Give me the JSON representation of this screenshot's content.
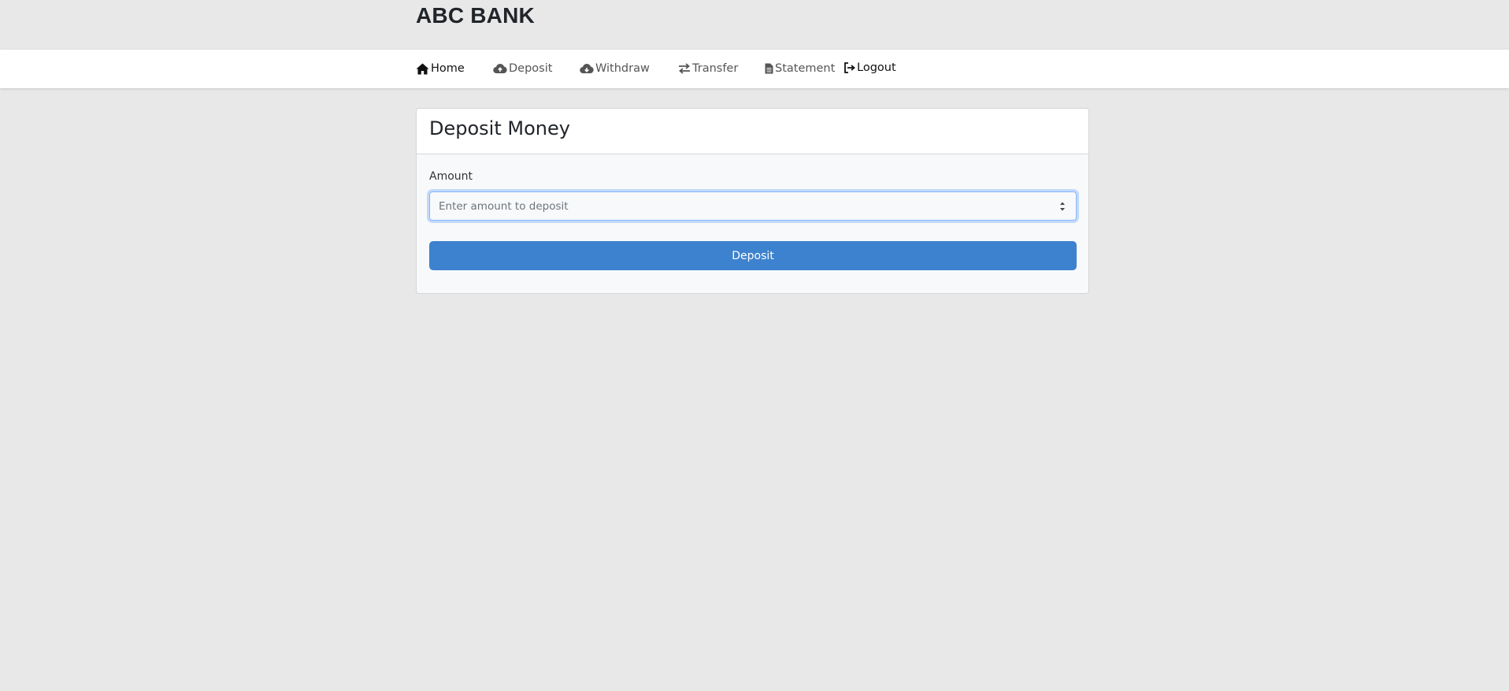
{
  "app": {
    "brand": "ABC BANK"
  },
  "nav": {
    "items": [
      {
        "label": "Home",
        "icon": "home-icon"
      },
      {
        "label": "Deposit",
        "icon": "cloud-upload-icon"
      },
      {
        "label": "Withdraw",
        "icon": "cloud-download-icon"
      },
      {
        "label": "Transfer",
        "icon": "arrows-exchange-icon"
      },
      {
        "label": "Statement",
        "icon": "document-icon"
      },
      {
        "label": "Logout",
        "icon": "logout-icon"
      }
    ]
  },
  "form": {
    "title": "Deposit Money",
    "amount_label": "Amount",
    "amount_placeholder": "Enter amount to deposit",
    "amount_value": "",
    "submit_label": "Deposit"
  },
  "colors": {
    "page_background": "#e8e8e8",
    "primary_button": "#3d82ce",
    "focus_border": "#86b7fe"
  }
}
